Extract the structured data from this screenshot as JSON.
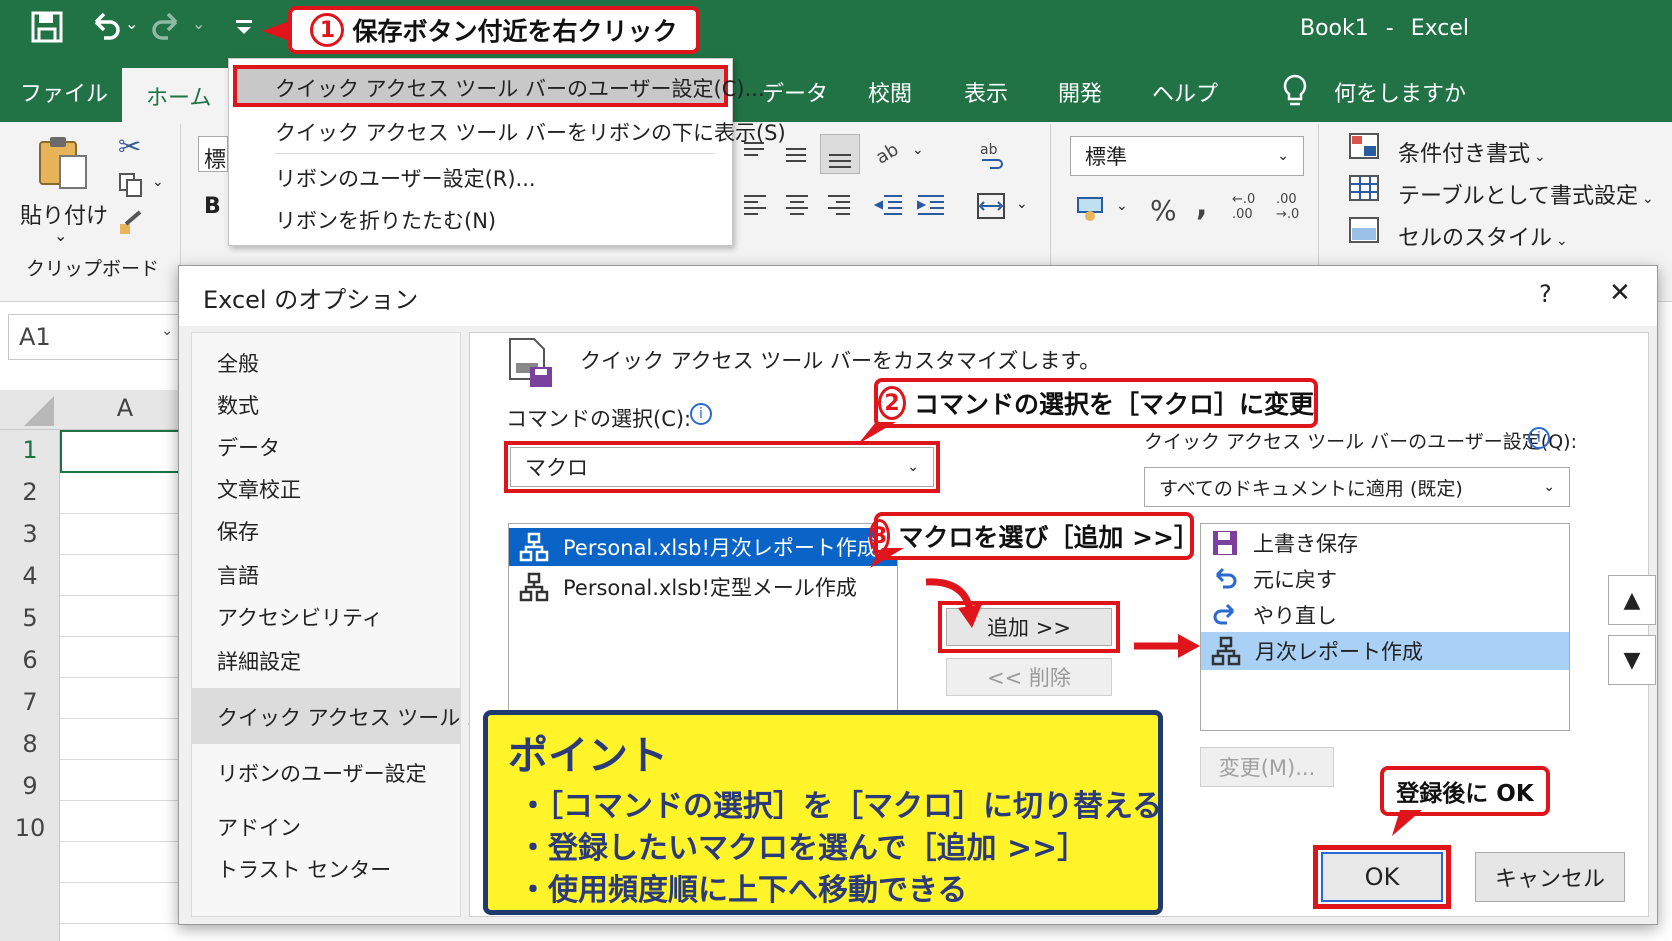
{
  "titlebar": {
    "doc": "Book1",
    "sep": "-",
    "app": "Excel"
  },
  "tabs": [
    "ファイル",
    "ホーム",
    "データ",
    "校閲",
    "表示",
    "開発",
    "ヘルプ"
  ],
  "tell_me": "何をしますか",
  "ribbon": {
    "paste": "貼り付け",
    "clipboard_group": "クリップボード",
    "number_format": "標準",
    "cond_format": "条件付き書式",
    "table_format": "テーブルとして書式設定",
    "cell_style": "セルのスタイル",
    "percent": "%",
    "comma": ",",
    "inc_dec_top": "←.0",
    "inc_dec_bottom": ".00",
    "dec_dec_top": ".00",
    "dec_dec_bottom": "→.0",
    "font_partial_1": "標",
    "font_partial_2": "B"
  },
  "callouts": {
    "c1_num": "1",
    "c1_text": "保存ボタン付近を右クリック",
    "c2_num": "2",
    "c2_text": "コマンドの選択を［マクロ］に変更",
    "c3_num": "3",
    "c3_text": "マクロを選び［追加 >>］",
    "c4_text": "登録後に OK"
  },
  "context_menu": [
    "クイック アクセス ツール バーのユーザー設定(C)...",
    "クイック アクセス ツール バーをリボンの下に表示(S)",
    "リボンのユーザー設定(R)...",
    "リボンを折りたたむ(N)"
  ],
  "sheet": {
    "namebox": "A1",
    "col_a": "A",
    "rows": [
      "1",
      "2",
      "3",
      "4",
      "5",
      "6",
      "7",
      "8",
      "9",
      "10"
    ]
  },
  "dialog": {
    "title": "Excel のオプション",
    "help": "?",
    "close": "✕",
    "nav": [
      "全般",
      "数式",
      "データ",
      "文章校正",
      "保存",
      "言語",
      "アクセシビリティ",
      "詳細設定",
      "クイック アクセス ツール バー",
      "リボンのユーザー設定",
      "アドイン",
      "トラスト センター"
    ],
    "heading": "クイック アクセス ツール バーをカスタマイズします。",
    "choose_label": "コマンドの選択(C):",
    "choose_value": "マクロ",
    "customize_label": "クイック アクセス ツール バーのユーザー設定(Q):",
    "customize_value": "すべてのドキュメントに適用 (既定)",
    "info": "i",
    "macros": [
      "Personal.xlsb!月次レポート作成",
      "Personal.xlsb!定型メール作成"
    ],
    "qat_items": [
      "上書き保存",
      "元に戻す",
      "やり直し",
      "月次レポート作成"
    ],
    "add_btn": "追加 >>",
    "remove_btn": "<< 削除",
    "modify_btn": "変更(M)...",
    "ok_btn": "OK",
    "cancel_btn": "キャンセル",
    "up": "▲",
    "down": "▼"
  },
  "point": {
    "heading": "ポイント",
    "bullets": [
      "・［コマンドの選択］を［マクロ］に切り替える",
      "・登録したいマクロを選んで［追加 >>］",
      "・使用頻度順に上下へ移動できる"
    ]
  },
  "colors": {
    "excel_green": "#217346",
    "callout_red": "#e0141b",
    "point_yellow": "#fff42a",
    "point_navy": "#1f3a6e",
    "selection_blue": "#0a64c8"
  }
}
